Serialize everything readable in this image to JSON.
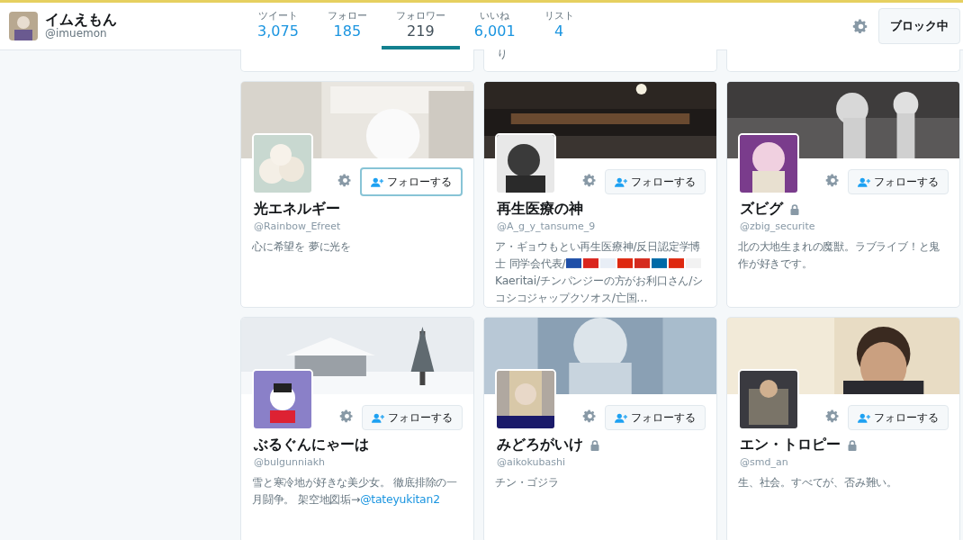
{
  "profile": {
    "name": "イムえもん",
    "handle": "@imuemon"
  },
  "stats": [
    {
      "label": "ツイート",
      "value": "3,075",
      "selected": false
    },
    {
      "label": "フォロー",
      "value": "185",
      "selected": false
    },
    {
      "label": "フォロワー",
      "value": "219",
      "selected": true
    },
    {
      "label": "いいね",
      "value": "6,001",
      "selected": false
    },
    {
      "label": "リスト",
      "value": "4",
      "selected": false
    }
  ],
  "block_button": "ブロック中",
  "partial_cards": [
    {
      "kind": "blank"
    },
    {
      "kind": "text",
      "text": "り"
    },
    {
      "kind": "blank"
    }
  ],
  "cards": [
    {
      "name": "光エネルギー",
      "handle": "@Rainbow_Efreet",
      "protected": false,
      "follow": "フォローする",
      "focused": true,
      "bio": [
        {
          "kind": "text",
          "text": "心に希望を 夢に光を"
        }
      ]
    },
    {
      "name": "再生医療の神",
      "handle": "@A_g_y_tansume_9",
      "protected": false,
      "follow": "フォローする",
      "focused": false,
      "bio": [
        {
          "kind": "text",
          "text": "ア・ギョウもとい再生医療神/反日認定学博士 同学会代表/"
        },
        {
          "kind": "flag",
          "color": "#1f4fa8"
        },
        {
          "kind": "flag",
          "color": "#da251d"
        },
        {
          "kind": "flag",
          "color": "#e8eef6"
        },
        {
          "kind": "flag",
          "color": "#de2910"
        },
        {
          "kind": "flag",
          "color": "#d52b1e"
        },
        {
          "kind": "flag",
          "color": "#006aa7"
        },
        {
          "kind": "flag",
          "color": "#de2910"
        },
        {
          "kind": "flag",
          "color": "#f2f2f2"
        },
        {
          "kind": "text",
          "text": "Kaeritai/チンパンジーの方がお利口さん/シコシコジャップクソオス/亡国…"
        }
      ]
    },
    {
      "name": "ズビグ",
      "handle": "@zbig_securite",
      "protected": true,
      "follow": "フォローする",
      "focused": false,
      "bio": [
        {
          "kind": "text",
          "text": "北の大地生まれの魔獣。ラブライブ！と鬼作が好きです。"
        }
      ]
    },
    {
      "name": "ぶるぐんにゃーは",
      "handle": "@bulgunniakh",
      "protected": false,
      "follow": "フォローする",
      "focused": false,
      "bio": [
        {
          "kind": "text",
          "text": "雪と寒冷地が好きな美少女。 徹底排除の一月闘争。 架空地図垢→"
        },
        {
          "kind": "link",
          "text": "@tateyukitan2"
        }
      ]
    },
    {
      "name": "みどろがいけ",
      "handle": "@aikokubashi",
      "protected": true,
      "follow": "フォローする",
      "focused": false,
      "bio": [
        {
          "kind": "text",
          "text": "チン・ゴジラ"
        }
      ]
    },
    {
      "name": "エン・トロピー",
      "handle": "@smd_an",
      "protected": true,
      "follow": "フォローする",
      "focused": false,
      "bio": [
        {
          "kind": "text",
          "text": "生、社会。すべてが、否み難い。"
        }
      ]
    }
  ]
}
